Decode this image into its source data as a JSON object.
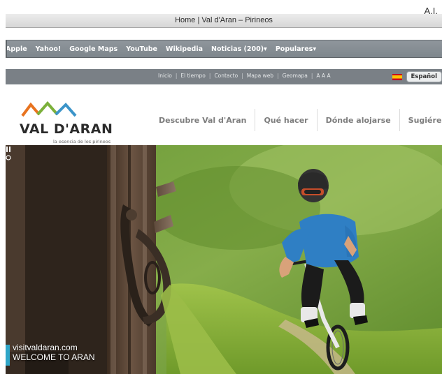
{
  "corner_label": "A.I.",
  "window": {
    "title": "Home | Val d'Aran – Pirineos"
  },
  "bookmarks": [
    "Apple",
    "Yahoo!",
    "Google Maps",
    "YouTube",
    "Wikipedia",
    "Noticias (200)▾",
    "Populares▾"
  ],
  "topnav": {
    "links": [
      "Inicio",
      "El tiempo",
      "Contacto",
      "Mapa web",
      "Geomapa"
    ],
    "font_size": "A A A",
    "language": "Español"
  },
  "site": {
    "logo": "VAL D'ARAN",
    "tagline": "la esencia de los pirineos",
    "nav": [
      "Descubre Val d'Aran",
      "Qué hacer",
      "Dónde alojarse",
      "Sugiéreme"
    ]
  },
  "hero": {
    "caption_line1": "visitvaldaran.com",
    "caption_line2": "WELCOME TO ARAN"
  },
  "colors": {
    "logo_orange": "#e8731f",
    "logo_green": "#7bb03a",
    "logo_blue": "#3b94c9",
    "caption_accent": "#2fa6c8"
  }
}
